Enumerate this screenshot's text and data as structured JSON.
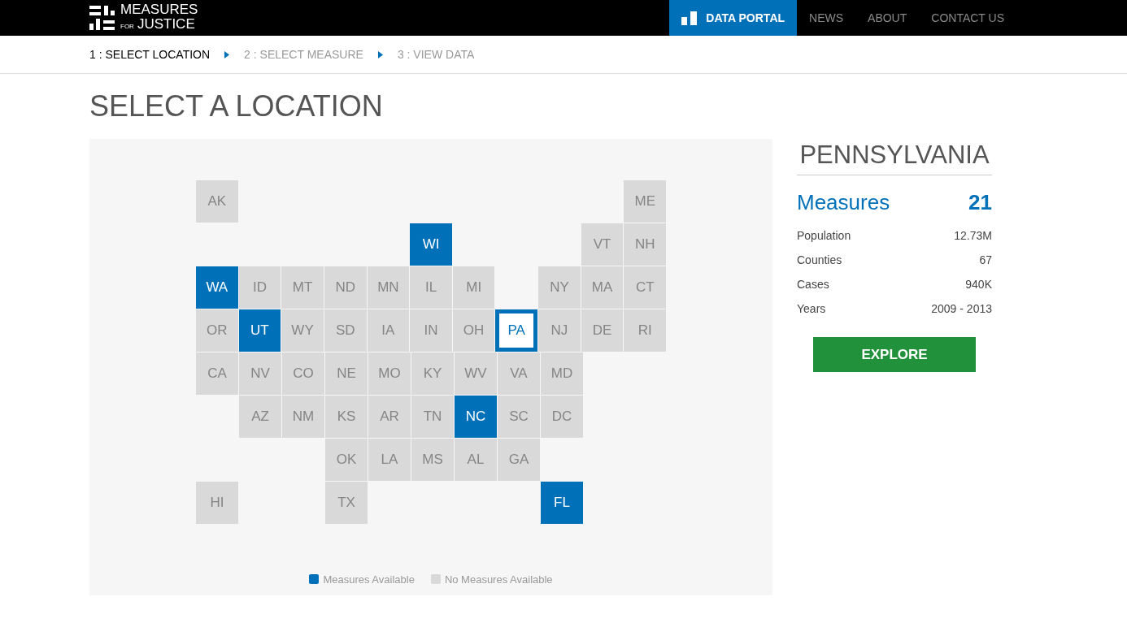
{
  "logo": {
    "line_1": "MEASURES",
    "small": "FOR",
    "line_2": "JUSTICE"
  },
  "nav": [
    {
      "label": "DATA PORTAL",
      "selected": true
    },
    {
      "label": "NEWS",
      "selected": false
    },
    {
      "label": "ABOUT",
      "selected": false
    },
    {
      "label": "CONTACT US",
      "selected": false
    }
  ],
  "steps": [
    {
      "label": "1 : SELECT LOCATION",
      "selected": true
    },
    {
      "label": "2 : SELECT MEASURE",
      "selected": false
    },
    {
      "label": "3 : VIEW DATA",
      "selected": false
    }
  ],
  "page_title": "SELECT A LOCATION",
  "map": {
    "rows": [
      [
        {
          "kind": "state",
          "code": "AK",
          "available": false,
          "selected": false
        },
        {
          "kind": "gap"
        },
        {
          "kind": "gap"
        },
        {
          "kind": "gap"
        },
        {
          "kind": "gap"
        },
        {
          "kind": "gap"
        },
        {
          "kind": "gap"
        },
        {
          "kind": "gap"
        },
        {
          "kind": "gap"
        },
        {
          "kind": "gap"
        },
        {
          "kind": "state",
          "code": "ME",
          "available": false,
          "selected": false
        }
      ],
      [
        {
          "kind": "gap"
        },
        {
          "kind": "gap"
        },
        {
          "kind": "gap"
        },
        {
          "kind": "gap"
        },
        {
          "kind": "gap"
        },
        {
          "kind": "state",
          "code": "WI",
          "available": true,
          "selected": false
        },
        {
          "kind": "gap"
        },
        {
          "kind": "gap"
        },
        {
          "kind": "gap"
        },
        {
          "kind": "state",
          "code": "VT",
          "available": false,
          "selected": false
        },
        {
          "kind": "state",
          "code": "NH",
          "available": false,
          "selected": false
        }
      ],
      [
        {
          "kind": "state",
          "code": "WA",
          "available": true,
          "selected": false
        },
        {
          "kind": "state",
          "code": "ID",
          "available": false,
          "selected": false
        },
        {
          "kind": "state",
          "code": "MT",
          "available": false,
          "selected": false
        },
        {
          "kind": "state",
          "code": "ND",
          "available": false,
          "selected": false
        },
        {
          "kind": "state",
          "code": "MN",
          "available": false,
          "selected": false
        },
        {
          "kind": "state",
          "code": "IL",
          "available": false,
          "selected": false
        },
        {
          "kind": "state",
          "code": "MI",
          "available": false,
          "selected": false
        },
        {
          "kind": "gap"
        },
        {
          "kind": "state",
          "code": "NY",
          "available": false,
          "selected": false
        },
        {
          "kind": "state",
          "code": "MA",
          "available": false,
          "selected": false
        },
        {
          "kind": "state",
          "code": "CT",
          "available": false,
          "selected": false
        }
      ],
      [
        {
          "kind": "state",
          "code": "OR",
          "available": false,
          "selected": false
        },
        {
          "kind": "state",
          "code": "UT",
          "available": true,
          "selected": false
        },
        {
          "kind": "state",
          "code": "WY",
          "available": false,
          "selected": false
        },
        {
          "kind": "state",
          "code": "SD",
          "available": false,
          "selected": false
        },
        {
          "kind": "state",
          "code": "IA",
          "available": false,
          "selected": false
        },
        {
          "kind": "state",
          "code": "IN",
          "available": false,
          "selected": false
        },
        {
          "kind": "state",
          "code": "OH",
          "available": false,
          "selected": false
        },
        {
          "kind": "state",
          "code": "PA",
          "available": true,
          "selected": true
        },
        {
          "kind": "state",
          "code": "NJ",
          "available": false,
          "selected": false
        },
        {
          "kind": "state",
          "code": "DE",
          "available": false,
          "selected": false
        },
        {
          "kind": "state",
          "code": "RI",
          "available": false,
          "selected": false
        }
      ],
      [
        {
          "kind": "state",
          "code": "CA",
          "available": false,
          "selected": false
        },
        {
          "kind": "state",
          "code": "NV",
          "available": false,
          "selected": false
        },
        {
          "kind": "state",
          "code": "CO",
          "available": false,
          "selected": false
        },
        {
          "kind": "state",
          "code": "NE",
          "available": false,
          "selected": false
        },
        {
          "kind": "state",
          "code": "MO",
          "available": false,
          "selected": false
        },
        {
          "kind": "state",
          "code": "KY",
          "available": false,
          "selected": false
        },
        {
          "kind": "state",
          "code": "WV",
          "available": false,
          "selected": false
        },
        {
          "kind": "state",
          "code": "VA",
          "available": false,
          "selected": false
        },
        {
          "kind": "state",
          "code": "MD",
          "available": false,
          "selected": false
        }
      ],
      [
        {
          "kind": "gap"
        },
        {
          "kind": "state",
          "code": "AZ",
          "available": false,
          "selected": false
        },
        {
          "kind": "state",
          "code": "NM",
          "available": false,
          "selected": false
        },
        {
          "kind": "state",
          "code": "KS",
          "available": false,
          "selected": false
        },
        {
          "kind": "state",
          "code": "AR",
          "available": false,
          "selected": false
        },
        {
          "kind": "state",
          "code": "TN",
          "available": false,
          "selected": false
        },
        {
          "kind": "state",
          "code": "NC",
          "available": true,
          "selected": false
        },
        {
          "kind": "state",
          "code": "SC",
          "available": false,
          "selected": false
        },
        {
          "kind": "state",
          "code": "DC",
          "available": false,
          "selected": false
        }
      ],
      [
        {
          "kind": "gap"
        },
        {
          "kind": "gap"
        },
        {
          "kind": "gap"
        },
        {
          "kind": "state",
          "code": "OK",
          "available": false,
          "selected": false
        },
        {
          "kind": "state",
          "code": "LA",
          "available": false,
          "selected": false
        },
        {
          "kind": "state",
          "code": "MS",
          "available": false,
          "selected": false
        },
        {
          "kind": "state",
          "code": "AL",
          "available": false,
          "selected": false
        },
        {
          "kind": "state",
          "code": "GA",
          "available": false,
          "selected": false
        }
      ],
      [
        {
          "kind": "state",
          "code": "HI",
          "available": false,
          "selected": false
        },
        {
          "kind": "gap"
        },
        {
          "kind": "gap"
        },
        {
          "kind": "state",
          "code": "TX",
          "available": false,
          "selected": false
        },
        {
          "kind": "gap"
        },
        {
          "kind": "gap"
        },
        {
          "kind": "gap"
        },
        {
          "kind": "gap"
        },
        {
          "kind": "state",
          "code": "FL",
          "available": true,
          "selected": false
        }
      ]
    ],
    "legend": [
      {
        "label": "Measures Available",
        "color": "#0071b9"
      },
      {
        "label": "No Measures Available",
        "color": "#d9d9d9"
      }
    ]
  },
  "detail": {
    "title": "PENNSYLVANIA",
    "measures_label": "Measures",
    "measures_value": "21",
    "stats": [
      {
        "label": "Population",
        "value": "12.73M"
      },
      {
        "label": "Counties",
        "value": "67"
      },
      {
        "label": "Cases",
        "value": "940K"
      },
      {
        "label": "Years",
        "value": "2009 - 2013"
      }
    ],
    "button": "EXPLORE"
  }
}
